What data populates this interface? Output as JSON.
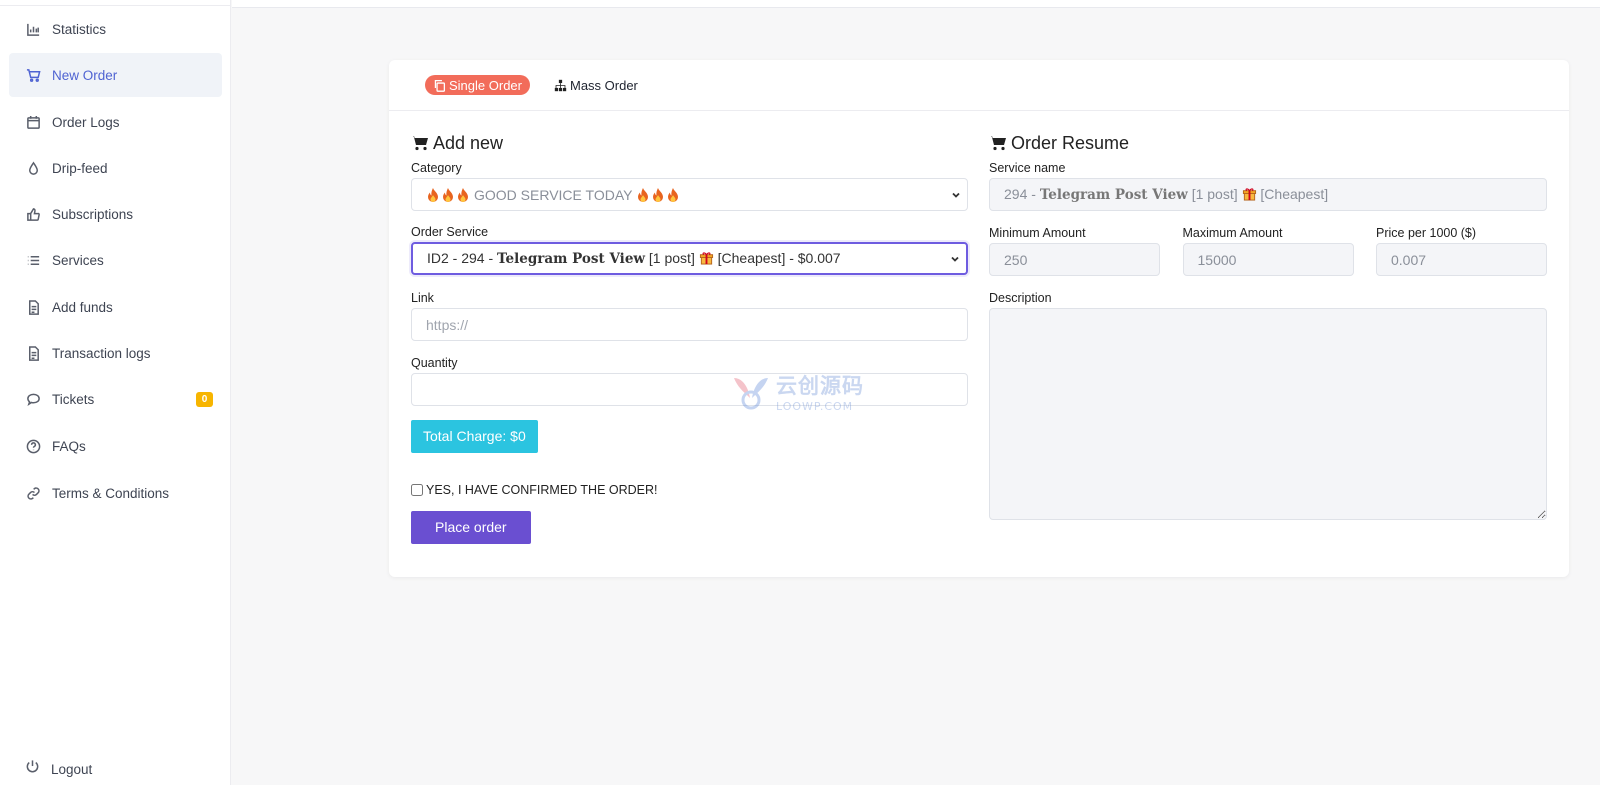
{
  "sidebar": {
    "items": [
      {
        "label": "Statistics",
        "icon": "bar-chart-icon"
      },
      {
        "label": "New Order",
        "icon": "cart-icon",
        "active": true
      },
      {
        "label": "Order Logs",
        "icon": "calendar-icon"
      },
      {
        "label": "Drip-feed",
        "icon": "drop-icon"
      },
      {
        "label": "Subscriptions",
        "icon": "thumbs-up-icon"
      },
      {
        "label": "Services",
        "icon": "list-icon"
      },
      {
        "label": "Add funds",
        "icon": "document-icon"
      },
      {
        "label": "Transaction logs",
        "icon": "document-icon"
      },
      {
        "label": "Tickets",
        "icon": "chat-icon",
        "badge": "0"
      },
      {
        "label": "FAQs",
        "icon": "question-icon"
      },
      {
        "label": "Terms & Conditions",
        "icon": "link-icon"
      }
    ],
    "logout_label": "Logout"
  },
  "tabs": {
    "single": "Single Order",
    "mass": "Mass Order"
  },
  "add_new": {
    "title": "Add new",
    "category_label": "Category",
    "category_value": "GOOD SERVICE TODAY",
    "order_service_label": "Order Service",
    "order_service_prefix": "ID2 - 294 - ",
    "order_service_name": "Telegram Post View",
    "order_service_mid": " [1 post] ",
    "order_service_suffix": " [Cheapest] - $0.007",
    "link_label": "Link",
    "link_placeholder": "https://",
    "quantity_label": "Quantity",
    "total_charge": "Total Charge: $0",
    "confirm_label": "YES, I HAVE CONFIRMED THE ORDER!",
    "place_order": "Place order"
  },
  "resume": {
    "title": "Order Resume",
    "service_name_label": "Service name",
    "service_prefix": "294 - ",
    "service_name": "Telegram Post View",
    "service_mid": " [1 post] ",
    "service_suffix": " [Cheapest]",
    "min_label": "Minimum Amount",
    "min_value": "250",
    "max_label": "Maximum Amount",
    "max_value": "15000",
    "price_label": "Price per 1000 ($)",
    "price_value": "0.007",
    "description_label": "Description"
  },
  "watermark": {
    "top": "云创源码",
    "bottom": "LOOWP.COM"
  },
  "colors": {
    "accent": "#6a4fd1",
    "active_nav": "#4f63d2",
    "single_tab": "#f26c5a",
    "charge": "#2bc4e0",
    "badge": "#f7b500"
  }
}
